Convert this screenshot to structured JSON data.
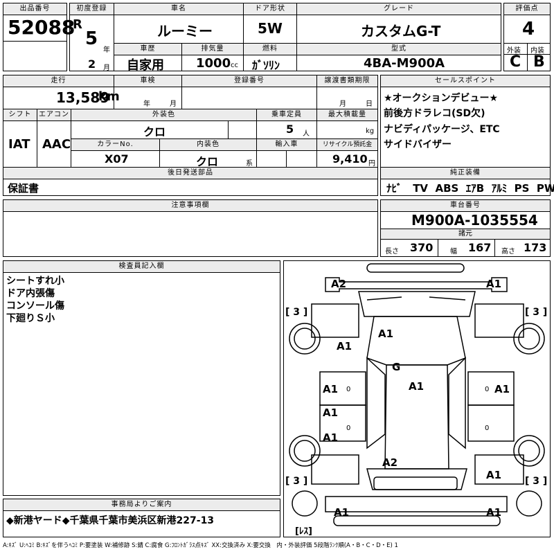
{
  "lot": {
    "label": "出品番号",
    "value": "52088"
  },
  "first_reg": {
    "label": "初度登録",
    "era": "R",
    "year": "5",
    "year_unit": "年",
    "month": "2",
    "month_unit": "月"
  },
  "car_name": {
    "label": "車名",
    "value": "ルーミー"
  },
  "doors": {
    "label": "ドア形状",
    "value": "5W"
  },
  "grade": {
    "label": "グレード",
    "value": "カスタムG-T"
  },
  "score": {
    "label": "評価点",
    "value": "4",
    "ext_label": "外装",
    "int_label": "内装",
    "ext": "C",
    "int": "B"
  },
  "history": {
    "label": "車歴",
    "value": "自家用"
  },
  "displacement": {
    "label": "排気量",
    "value": "1000",
    "unit": "cc"
  },
  "fuel": {
    "label": "燃料",
    "value": "ｶﾞｿﾘﾝ"
  },
  "model": {
    "label": "型式",
    "value": "4BA-M900A"
  },
  "mileage": {
    "label": "走行",
    "value": "13,589",
    "unit": "km"
  },
  "inspection": {
    "label": "車検",
    "year": "年",
    "month": "月"
  },
  "reg_no": {
    "label": "登録番号"
  },
  "transfer": {
    "label": "譲渡書類期限",
    "month": "月",
    "day": "日"
  },
  "shift": {
    "label": "シフト",
    "value": "IAT"
  },
  "aircon": {
    "label": "エアコン",
    "value": "AAC"
  },
  "ext_color": {
    "label": "外装色",
    "value": "クロ"
  },
  "capacity": {
    "label": "乗車定員",
    "value": "5",
    "unit": "人"
  },
  "max_load": {
    "label": "最大積載量",
    "unit": "kg"
  },
  "color_no": {
    "label": "カラーNo.",
    "value": "X07"
  },
  "int_color": {
    "label": "内装色",
    "value": "クロ",
    "unit": "系"
  },
  "import": {
    "label": "輸入車"
  },
  "recycle": {
    "label": "リサイクル預託金",
    "value": "9,410",
    "unit": "円"
  },
  "sales_points": {
    "label": "セールスポイント",
    "lines": [
      "★オークションデビュー★",
      "前後方ドラレコ(SD欠)",
      "ナビディパッケージ、ETC",
      "サイドバイザー"
    ]
  },
  "later_parts": {
    "label": "後日発送部品",
    "value": "保証書"
  },
  "equipment": {
    "label": "純正装備",
    "items": [
      "ﾅﾋﾞ",
      "TV",
      "ABS",
      "ｴｱB",
      "ｱﾙﾐ",
      "PS",
      "PW"
    ]
  },
  "notes": {
    "label": "注意事項欄"
  },
  "chassis": {
    "label": "車台番号",
    "value": "M900A-1035554"
  },
  "dims": {
    "label": "諸元",
    "len_label": "長さ",
    "len": "370",
    "wid_label": "幅",
    "wid": "167",
    "hei_label": "高さ",
    "hei": "173"
  },
  "inspector": {
    "label": "検査員記入欄",
    "lines": [
      "シートすれ小",
      "ドア内張傷",
      "コンソール傷",
      "下廻りＳ小"
    ]
  },
  "diagram": {
    "marks": [
      "A2",
      "A1",
      "A1",
      "A1",
      "G",
      "A1",
      "A1",
      "A1",
      "A1",
      "A1",
      "A2",
      "A1",
      "A1",
      "A1"
    ],
    "bracket": "[ 3 ]",
    "zeros": [
      "0",
      "0",
      "0",
      "0"
    ],
    "less": "[ﾚｽ]"
  },
  "office": {
    "label": "事務局よりご案内",
    "value": "◆新港ヤード◆千葉県千葉市美浜区新港227-13"
  },
  "legend": "A:ｷｽﾞ U:ﾍｺﾐ B:ｷｽﾞを伴うﾍｺﾐ P:要塗装 W:補修跡 S:錆 C:腐食 G:ﾌﾛﾝﾄｶﾞﾗｽ点ｷｽﾞ XX:交換済み X:要交換　内・外装評価 5段階ﾗﾝｸ順(A・B・C・D・E) 1"
}
